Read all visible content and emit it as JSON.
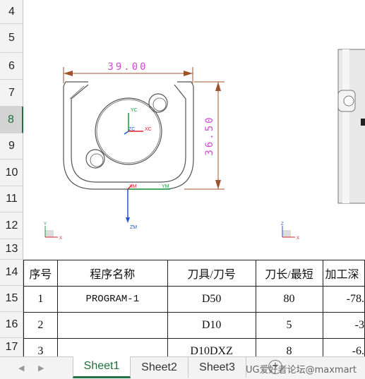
{
  "row_numbers": [
    "4",
    "5",
    "6",
    "7",
    "8",
    "9",
    "10",
    "11",
    "12",
    "13",
    "14",
    "15",
    "16",
    "17"
  ],
  "selected_row": "8",
  "drawing": {
    "dim_width": "39.00",
    "dim_height": "36.50",
    "axis_labels": {
      "yc": "YC",
      "xc": "XC",
      "zc": "ZC",
      "xm": "XM",
      "ym": "YM",
      "zm": "ZM"
    },
    "triad_left": {
      "y": "Y",
      "z": "Z",
      "x": "X"
    },
    "triad_right": {
      "y": "Z",
      "z": "Z",
      "x": "X"
    }
  },
  "table": {
    "headers": [
      "序号",
      "程序名称",
      "刀具/刀号",
      "刀长/最短",
      "加工深"
    ],
    "rows": [
      [
        "1",
        "PROGRAM-1",
        "D50",
        "80",
        "-78."
      ],
      [
        "2",
        "",
        "D10",
        "5",
        "-3"
      ],
      [
        "3",
        "",
        "D10DXZ",
        "8",
        "-6."
      ]
    ]
  },
  "sheet_tabs": [
    "Sheet1",
    "Sheet2",
    "Sheet3"
  ],
  "active_tab": "Sheet1",
  "add_sheet_icon": "+",
  "watermark": "UG爱好者论坛@maxmart",
  "colors": {
    "excel_green": "#217346",
    "dimension_magenta": "#d04bd0",
    "dimension_brown": "#a0522d"
  }
}
